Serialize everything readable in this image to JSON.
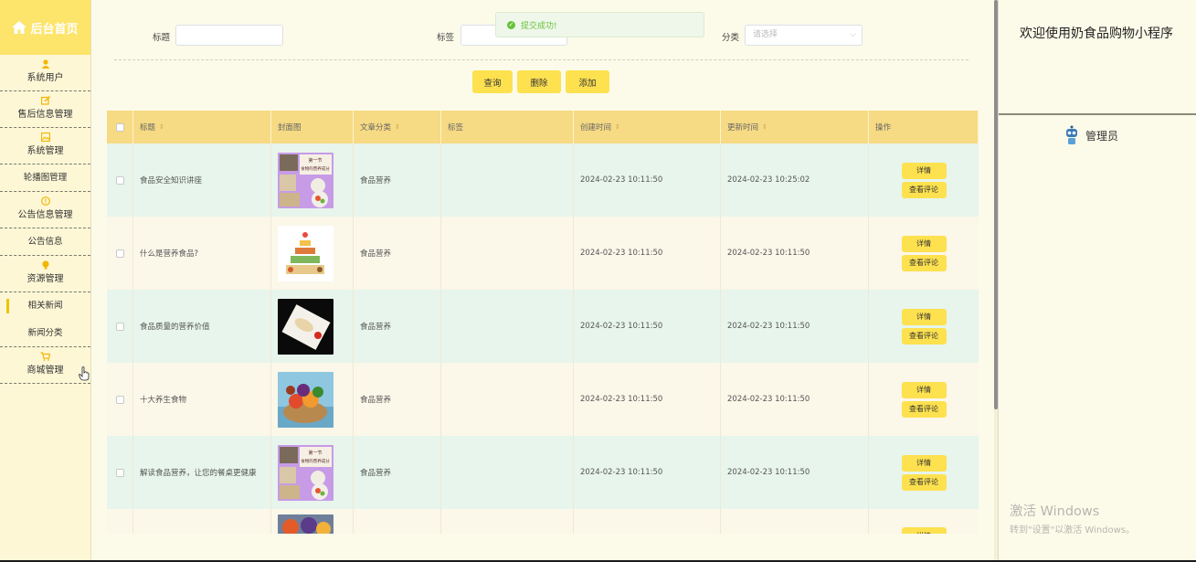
{
  "sidebar": {
    "brand": "后台首页",
    "groups": [
      {
        "label": "系统用户",
        "icon": "user-icon"
      },
      {
        "label": "售后信息管理",
        "icon": "edit-icon"
      },
      {
        "label": "系统管理",
        "icon": "picture-icon"
      },
      {
        "label": "公告信息管理",
        "icon": "info-icon"
      },
      {
        "label": "资源管理",
        "icon": "bulb-icon"
      },
      {
        "label": "商城管理",
        "icon": "cart-icon"
      }
    ],
    "subitems": {
      "carousel": "轮播图管理",
      "notice": "公告信息",
      "news": "相关新闻",
      "news_category": "新闻分类"
    }
  },
  "search": {
    "title_label": "标题",
    "tag_label": "标签",
    "category_label": "分类",
    "category_placeholder": "请选择"
  },
  "toast": {
    "text": "提交成功!",
    "color": "#67c23a"
  },
  "buttons": {
    "query": "查询",
    "delete": "删除",
    "add": "添加"
  },
  "table": {
    "headers": [
      "标题",
      "封面图",
      "文章分类",
      "标签",
      "创建时间",
      "更新时间",
      "操作"
    ],
    "rows": [
      {
        "title": "食品安全知识讲座",
        "category": "食品营养",
        "tag": "",
        "created": "2024-02-23 10:11:50",
        "updated": "2024-02-23 10:25:02",
        "cover": "nutrition-poster"
      },
      {
        "title": "什么是营养食品?",
        "category": "食品营养",
        "tag": "",
        "created": "2024-02-23 10:11:50",
        "updated": "2024-02-23 10:11:50",
        "cover": "food-pyramid"
      },
      {
        "title": "食品质量的营养价值",
        "category": "食品营养",
        "tag": "",
        "created": "2024-02-23 10:11:50",
        "updated": "2024-02-23 10:11:50",
        "cover": "plate-dark"
      },
      {
        "title": "十大养生食物",
        "category": "食品营养",
        "tag": "",
        "created": "2024-02-23 10:11:50",
        "updated": "2024-02-23 10:11:50",
        "cover": "fruit-basket"
      },
      {
        "title": "解读食品营养，让您的餐桌更健康",
        "category": "食品营养",
        "tag": "",
        "created": "2024-02-23 10:11:50",
        "updated": "2024-02-23 10:11:50",
        "cover": "nutrition-poster"
      }
    ],
    "detail_label": "详情",
    "comment_label": "查看评论"
  },
  "right": {
    "welcome": "欢迎使用奶食品购物小程序",
    "role": "管理员"
  },
  "watermark": {
    "line1": "激活 Windows",
    "line2": "转到\"设置\"以激活 Windows。"
  },
  "colors": {
    "accent": "#fde14f",
    "header_bg": "#f6da84",
    "row_green": "#e7f5ec",
    "row_cream": "#fbf7e9"
  }
}
